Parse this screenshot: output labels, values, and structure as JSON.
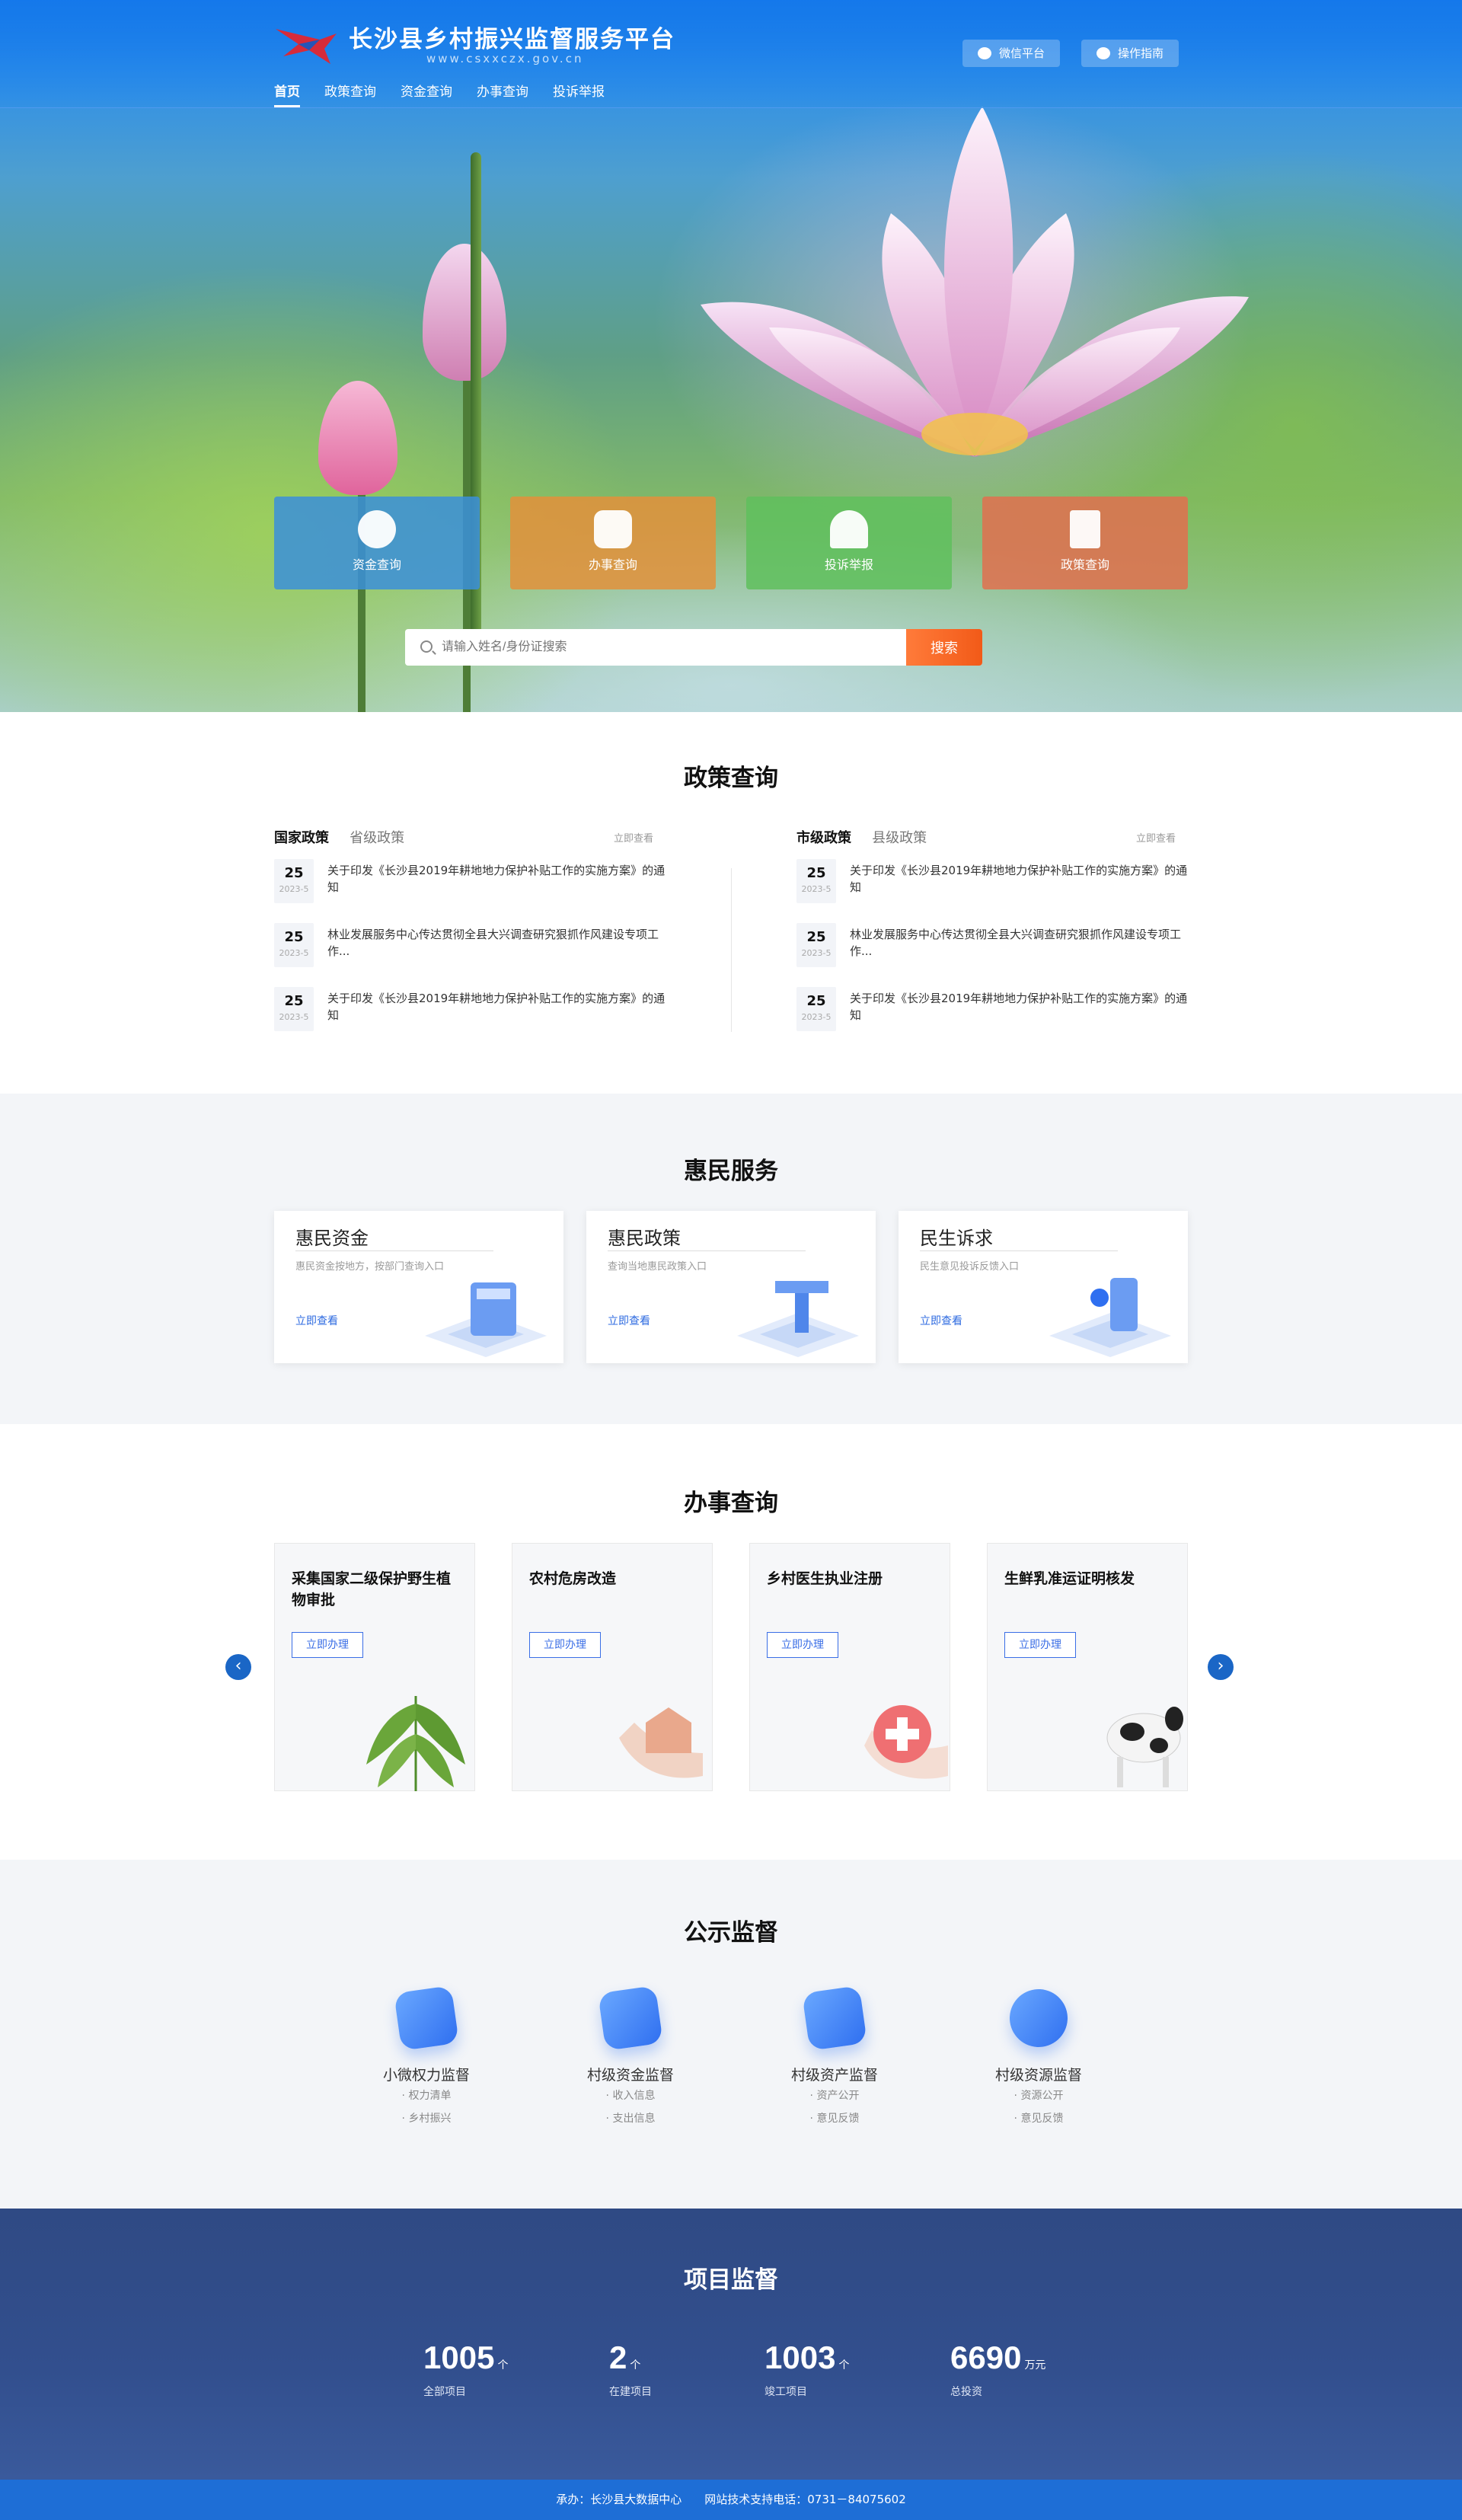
{
  "header": {
    "title": "长沙县乡村振兴监督服务平台",
    "domain": "www.csxxczx.gov.cn",
    "btn_wechat": "微信平台",
    "btn_guide": "操作指南"
  },
  "nav": [
    "首页",
    "政策查询",
    "资金查询",
    "办事查询",
    "投诉举报"
  ],
  "tiles": [
    {
      "label": "资金查询",
      "color": "#3b8fd9"
    },
    {
      "label": "办事查询",
      "color": "#e3913b"
    },
    {
      "label": "投诉举报",
      "color": "#5fbf5d"
    },
    {
      "label": "政策查询",
      "color": "#e0704f"
    }
  ],
  "search": {
    "placeholder": "请输入姓名/身份证搜索",
    "button": "搜索"
  },
  "policy": {
    "title": "政策查询",
    "left": {
      "tab_active": "国家政策",
      "tab_other": "省级政策",
      "more": "立即查看"
    },
    "right": {
      "tab_active": "市级政策",
      "tab_other": "县级政策",
      "more": "立即查看"
    },
    "items": [
      {
        "day": "25",
        "ym": "2023-5",
        "text": "关于印发《长沙县2019年耕地地力保护补贴工作的实施方案》的通知"
      },
      {
        "day": "25",
        "ym": "2023-5",
        "text": "林业发展服务中心传达贯彻全县大兴调查研究狠抓作风建设专项工作..."
      },
      {
        "day": "25",
        "ym": "2023-5",
        "text": "关于印发《长沙县2019年耕地地力保护补贴工作的实施方案》的通知"
      }
    ]
  },
  "benefit": {
    "title": "惠民服务",
    "cards": [
      {
        "title": "惠民资金",
        "desc": "惠民资金按地方，按部门查询入口",
        "link": "立即查看"
      },
      {
        "title": "惠民政策",
        "desc": "查询当地惠民政策入口",
        "link": "立即查看"
      },
      {
        "title": "民生诉求",
        "desc": "民生意见投诉反馈入口",
        "link": "立即查看"
      }
    ]
  },
  "office": {
    "title": "办事查询",
    "cards": [
      {
        "title": "采集国家二级保护野生植物审批",
        "btn": "立即办理"
      },
      {
        "title": "农村危房改造",
        "btn": "立即办理"
      },
      {
        "title": "乡村医生执业注册",
        "btn": "立即办理"
      },
      {
        "title": "生鲜乳准运证明核发",
        "btn": "立即办理"
      }
    ],
    "prev": "‹",
    "next": "›"
  },
  "supervision": {
    "title": "公示监督",
    "items": [
      {
        "title": "小微权力监督",
        "links": [
          "· 权力清单",
          "· 乡村振兴"
        ]
      },
      {
        "title": "村级资金监督",
        "links": [
          "· 收入信息",
          "· 支出信息"
        ]
      },
      {
        "title": "村级资产监督",
        "links": [
          "· 资产公开",
          "· 意见反馈"
        ]
      },
      {
        "title": "村级资源监督",
        "links": [
          "· 资源公开",
          "· 意见反馈"
        ]
      }
    ]
  },
  "projects": {
    "title": "项目监督",
    "stats": [
      {
        "value": "1005",
        "unit": "个",
        "label": "全部项目"
      },
      {
        "value": "2",
        "unit": "个",
        "label": "在建项目"
      },
      {
        "value": "1003",
        "unit": "个",
        "label": "竣工项目"
      },
      {
        "value": "6690",
        "unit": "万元",
        "label": "总投资"
      }
    ]
  },
  "footer": {
    "text": "承办：长沙县大数据中心　　网站技术支持电话：0731－84075602"
  }
}
